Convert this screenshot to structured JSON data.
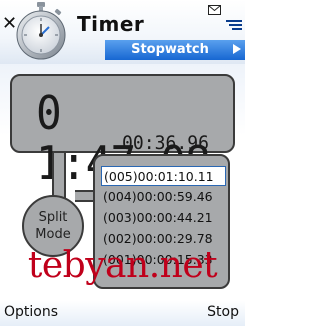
{
  "header": {
    "title": "Timer",
    "tab_label": "Stopwatch",
    "close_glyph": "✕",
    "icons": [
      "stopwatch-icon",
      "close-icon",
      "mail-icon",
      "signal-icon",
      "arrow-right-icon"
    ]
  },
  "stopwatch": {
    "main_time": "0 1:47.08",
    "lap_time": "00:36.96",
    "split_button": {
      "line1": "Split",
      "line2": "Mode"
    },
    "laps": [
      "(005)00:01:10.11",
      "(004)00:00:59.46",
      "(003)00:00:44.21",
      "(002)00:00:29.78",
      "(001)00:00:15.33"
    ]
  },
  "watermark": "tebyan.net",
  "softkeys": {
    "left": "Options",
    "right": "Stop"
  },
  "colors": {
    "panel": "#a7a9ab",
    "panel_border": "#3b3b3b",
    "tab_blue": "#1767d2",
    "watermark": "#c0001b"
  }
}
